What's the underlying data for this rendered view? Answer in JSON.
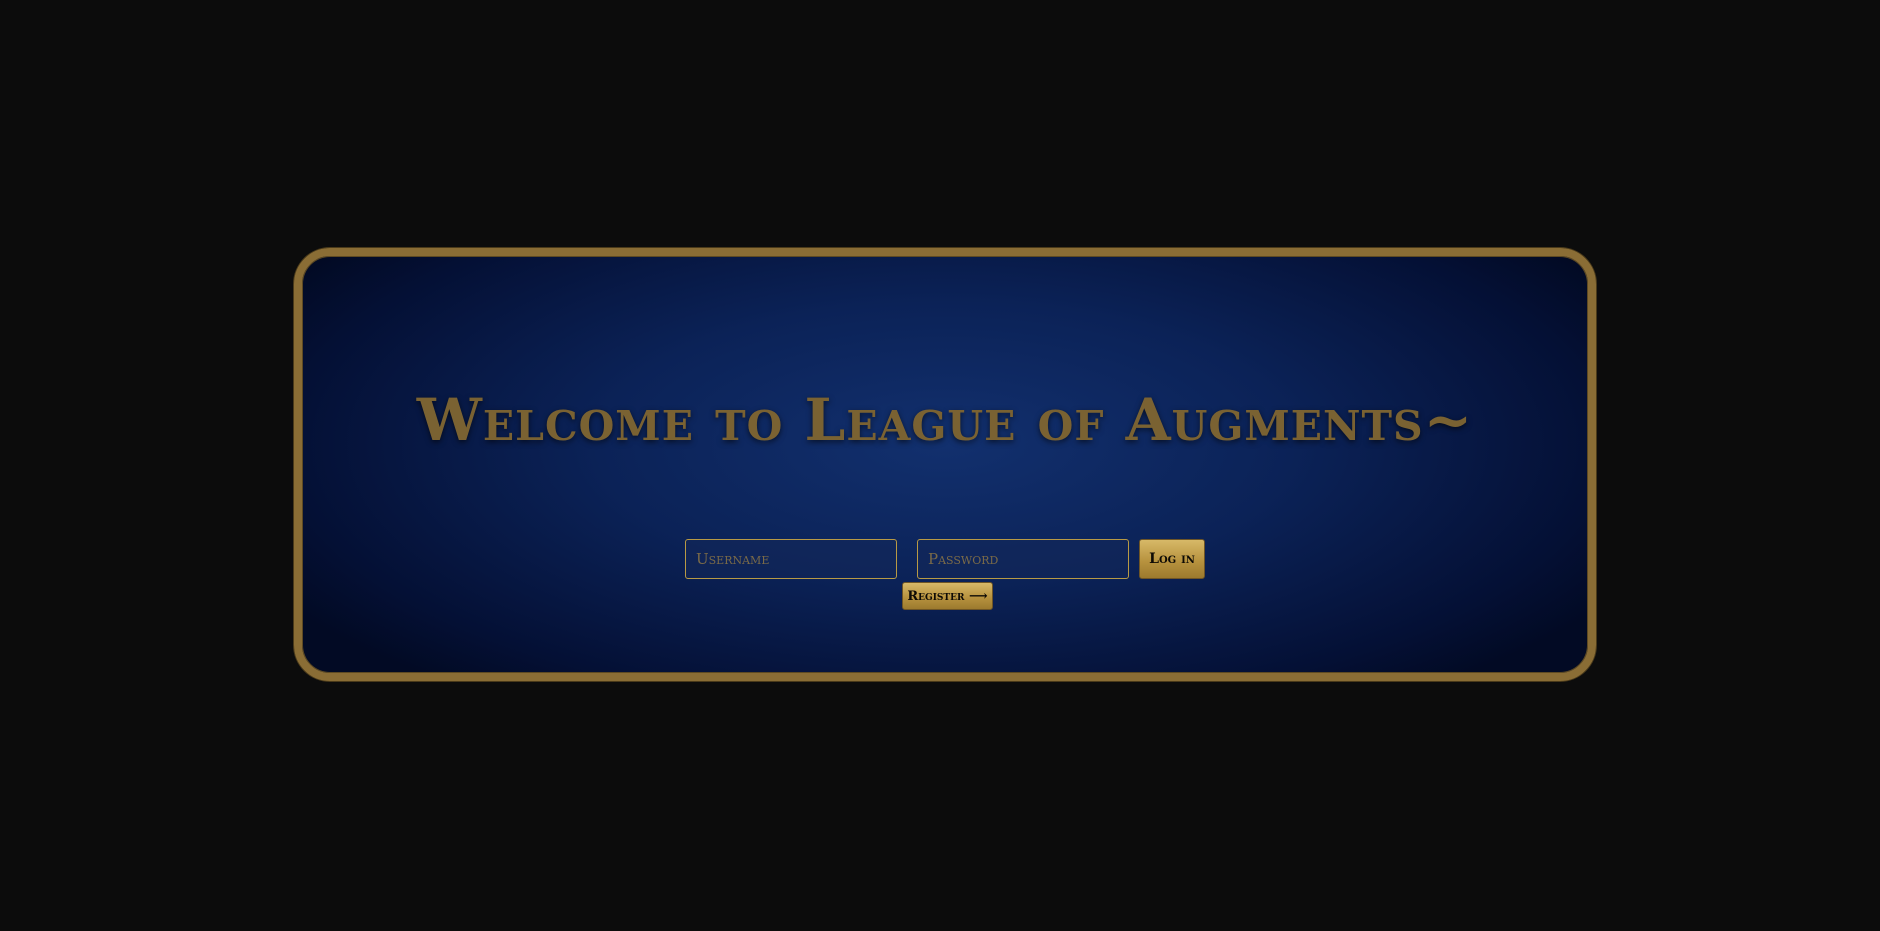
{
  "page": {
    "title": "Welcome to League of Augments~"
  },
  "login_form": {
    "username_placeholder": "Username",
    "password_placeholder": "Password",
    "login_label": "Log in",
    "register_label": "Register ⟶"
  },
  "colors": {
    "background": "#0c0c0c",
    "card_border_gold": "#8a6d35",
    "card_blue": "#0b2257",
    "title_gold": "#7a6232",
    "button_gold": "#c9a552"
  }
}
